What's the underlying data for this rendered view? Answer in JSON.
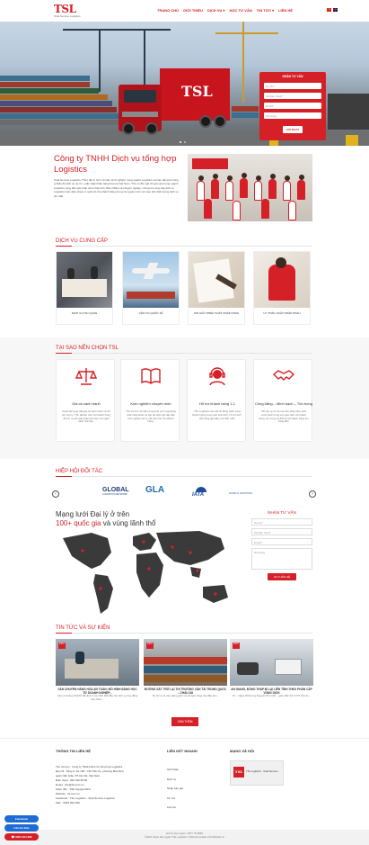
{
  "header": {
    "logo": "TSL",
    "logo_tagline": "Total Service Logistics",
    "nav": [
      "TRANG CHỦ",
      "GIỚI THIỆU",
      "DỊCH VỤ ▾",
      "HỌC TƯ VẤN",
      "TIN TỨC ▾",
      "LIÊN HỆ"
    ]
  },
  "hero": {
    "truck_logo": "TSL",
    "form": {
      "title": "NHẬN TƯ VẤN",
      "fields": [
        "Họ tên*",
        "Số điện thoại*",
        "Email*",
        "Nội dung"
      ],
      "submit": "GỬI NGAY"
    }
  },
  "company": {
    "title": "Công ty TNHH Dịch vụ tổng hợp Logistics",
    "description": "Total Service Logistics (TSL) đã có hơn 10 năm kinh nghiệm trong ngành Logistics và hiện đang là Công ty Đầu đủ dịch vụ Uy tín, xuất nhập khẩu hàng hóa tại Việt Nam. TSL có đội ngũ chuyên gia trong ngành Logistics cùng đội ngũ nhân viên nhiệt tình, Biên Nhận và chuyên nghiệp, chúng tôi cung cấp dịch vụ Logistics toàn diện phạm vi quốc tế cho khách hàng trong và ngoài nước với cam kết chất lượng dịch vụ tốt nhất."
  },
  "services": {
    "heading": "DỊCH VỤ CUNG CẤP",
    "items": [
      {
        "label": "DỊCH VỤ HẢI QUAN"
      },
      {
        "label": "VẬN TẢI QUỐC TẾ"
      },
      {
        "label": "XIN GIẤY PHÉP XUẤT NHẬP KHẨU"
      },
      {
        "label": "ỦY THÁC XUẤT NHẬP KHẨU"
      }
    ]
  },
  "why": {
    "heading": "TẠI SAO NÊN CHỌN TSL",
    "items": [
      {
        "icon": "scales-icon",
        "title": "Giá cả cạnh tranh",
        "desc": "Cạnh tiết cung cấp giá cả cạnh tranh và chi phí hợp lý. TSL đã làm việc với khách hàng để tìm ra các giải pháp phù hợp với ngân sách của bạn."
      },
      {
        "icon": "book-icon",
        "title": "Kinh nghiệm chuyên môn",
        "desc": "TSL có hơn 10 năm trong lĩnh vực hoạt động xuất nhập khẩu và vận tải. Đội ngũ dày dặn kinh nghiệm sẽ tư vấn tận tình cho khách hàng."
      },
      {
        "icon": "support-icon",
        "title": "Hỗ trợ khách hàng 1-1",
        "desc": "TSL Logistics cam kết sẽ đồng hành cùng khách hàng trong suốt quá trình, hỗ trợ 24/7, sẵn sàng giải đáp mọi thắc mắc."
      },
      {
        "icon": "handshake-icon",
        "title": "Công bằng – Minh bạch – Tôn trọng",
        "desc": "TSL lấy uy tín là mục tiêu phát triển, luôn minh bạch trong mọi giao dịch với khách hàng, tôn trọng và đặt lợi ích khách hàng lên hàng đầu."
      }
    ]
  },
  "partners": {
    "heading": "HIỆP HỘI ĐỐI TÁC",
    "logos": [
      "GLOBAL",
      "LOGISTICS NETWORK",
      "GLA",
      "IATA",
      "WORLD SHIPPING"
    ]
  },
  "network": {
    "title_line1": "Mạng lưới Đại lý ở trên",
    "title_highlight": "100+ quốc gia",
    "title_line2": " và vùng lãnh thổ",
    "form": {
      "title": "NHẬN TƯ VẤN",
      "fields": [
        "Họ tên*",
        "Số điện thoại*",
        "Email*",
        "Nội dung"
      ],
      "submit": "GỬI LIÊN HỆ"
    }
  },
  "news": {
    "heading": "TIN TỨC VÀ SỰ KIỆN",
    "items": [
      {
        "badge": "25/07",
        "title": "VẬN CHUYỂN HÀNG HÓA AN TOÀN: MÔ HÌNH ĐẢNG HỌC TỪ DOANH NGHIỆP...",
        "desc": "Cảm ơn hàng VIQUIO đã được hợp nhất. Bắt đầu các dịch vụ hợp đồng bảo hiểm..."
      },
      {
        "badge": "25/07",
        "title": "ĐƯỜNG SẮT TRỞ LẠI THỊ TRƯỜNG VẬN TẢI TRUNG QUỐC – CHÂU ÂU",
        "desc": "Tin tức từ lạ việc giảng giới: tàu chuyến hàng hóa đầu tiên..."
      },
      {
        "badge": "25/07",
        "title": "AN GIANG, ĐỒNG THÁP ĐI LẠI LIÊN TỈNH THEO PHÂN CẤP VÙNG DỊCH",
        "desc": "Từ – Ngày 26/10 ông Nguyễn Phú Cần – giám đốc Sở GTVT tỉnh An..."
      }
    ],
    "more": "XEM THÊM"
  },
  "footer": {
    "contact_heading": "THÔNG TIN LIÊN HỆ",
    "contact_lines": [
      "Tên công ty : Công ty TNHH Dịch Vụ tổng hợp Logistics",
      "Địa chỉ : Tầng 3, Số 728 - 730 Tiền Kỳ, phường Mai Dịch,",
      "quận Cầu Giấy, TP Hà Nội, Việt Nam",
      "Điện thoại : 092 190 85 86",
      "Email : info@tsl.com.vn",
      "Giám đốc : Trần Nguyệt Minh",
      "Website : tsl.com.vn",
      "Facebook : TSL Logistics - Total Service Logistics",
      "Zalo : 0903 494 399"
    ],
    "links_heading": "LIÊN KẾT NHANH",
    "links": [
      "Giới thiệu",
      "Dịch vụ",
      "Nhận báo giá",
      "Tin tức",
      "Liên hệ"
    ],
    "social_heading": "MẠNG XÃ HỘI",
    "fb_box": "TSL Logistics - Total Service...",
    "copyright1": "Hỗ trợ trực tuyến : 0977 79 3893",
    "copyright2": "©2021 thuộc bản quyền TSL Logistics | Thiết kế website bởi Website.vn"
  },
  "floating": {
    "btn1": "Facebook",
    "btn2": "Liên hệ Zalo",
    "phone": "0903 494 399"
  },
  "colors": {
    "accent": "#d62027"
  }
}
